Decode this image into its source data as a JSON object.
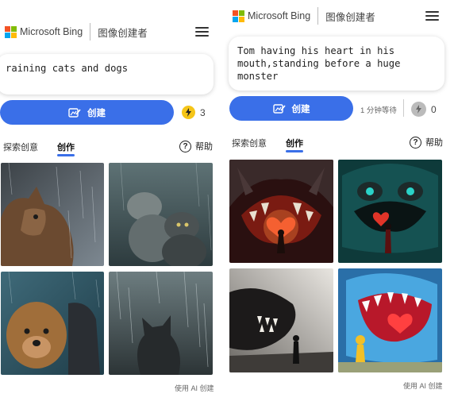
{
  "left": {
    "header": {
      "brand": "Microsoft Bing",
      "title": "图像创建者"
    },
    "prompt": "raining cats and dogs",
    "create_label": "创建",
    "boost_count": "3",
    "tabs": {
      "explore": "探索创意",
      "create": "创作"
    },
    "help_label": "帮助",
    "images": [
      {
        "description": "cat-in-rain-looking-up",
        "icon": "image"
      },
      {
        "description": "two-cats-in-rain",
        "icon": "image"
      },
      {
        "description": "dogs-in-rain",
        "icon": "image"
      },
      {
        "description": "cat-silhouette-in-rain",
        "icon": "image"
      }
    ],
    "footer": "使用 AI 创建"
  },
  "right": {
    "header": {
      "brand": "Microsoft Bing",
      "title": "图像创建者"
    },
    "prompt": "Tom having his heart in his\nmouth,standing before a huge\nmonster",
    "create_label": "创建",
    "wait_label": "1 分钟等待",
    "boost_count": "0",
    "tabs": {
      "explore": "探索创意",
      "create": "创作"
    },
    "help_label": "帮助",
    "images": [
      {
        "description": "cat-monster-heart",
        "icon": "image"
      },
      {
        "description": "teal-monster-child",
        "icon": "image"
      },
      {
        "description": "shark-monster-silhouette",
        "icon": "image"
      },
      {
        "description": "blue-monster-heart-mouth",
        "icon": "image"
      }
    ],
    "footer": "使用 AI 创建"
  },
  "colors": {
    "accent": "#3a6fe8",
    "logo_red": "#f35325",
    "logo_green": "#81bc06",
    "logo_blue": "#05a6f0",
    "logo_yellow": "#ffba08",
    "boost_active": "#f5c518",
    "boost_empty": "#bbbbbb"
  }
}
